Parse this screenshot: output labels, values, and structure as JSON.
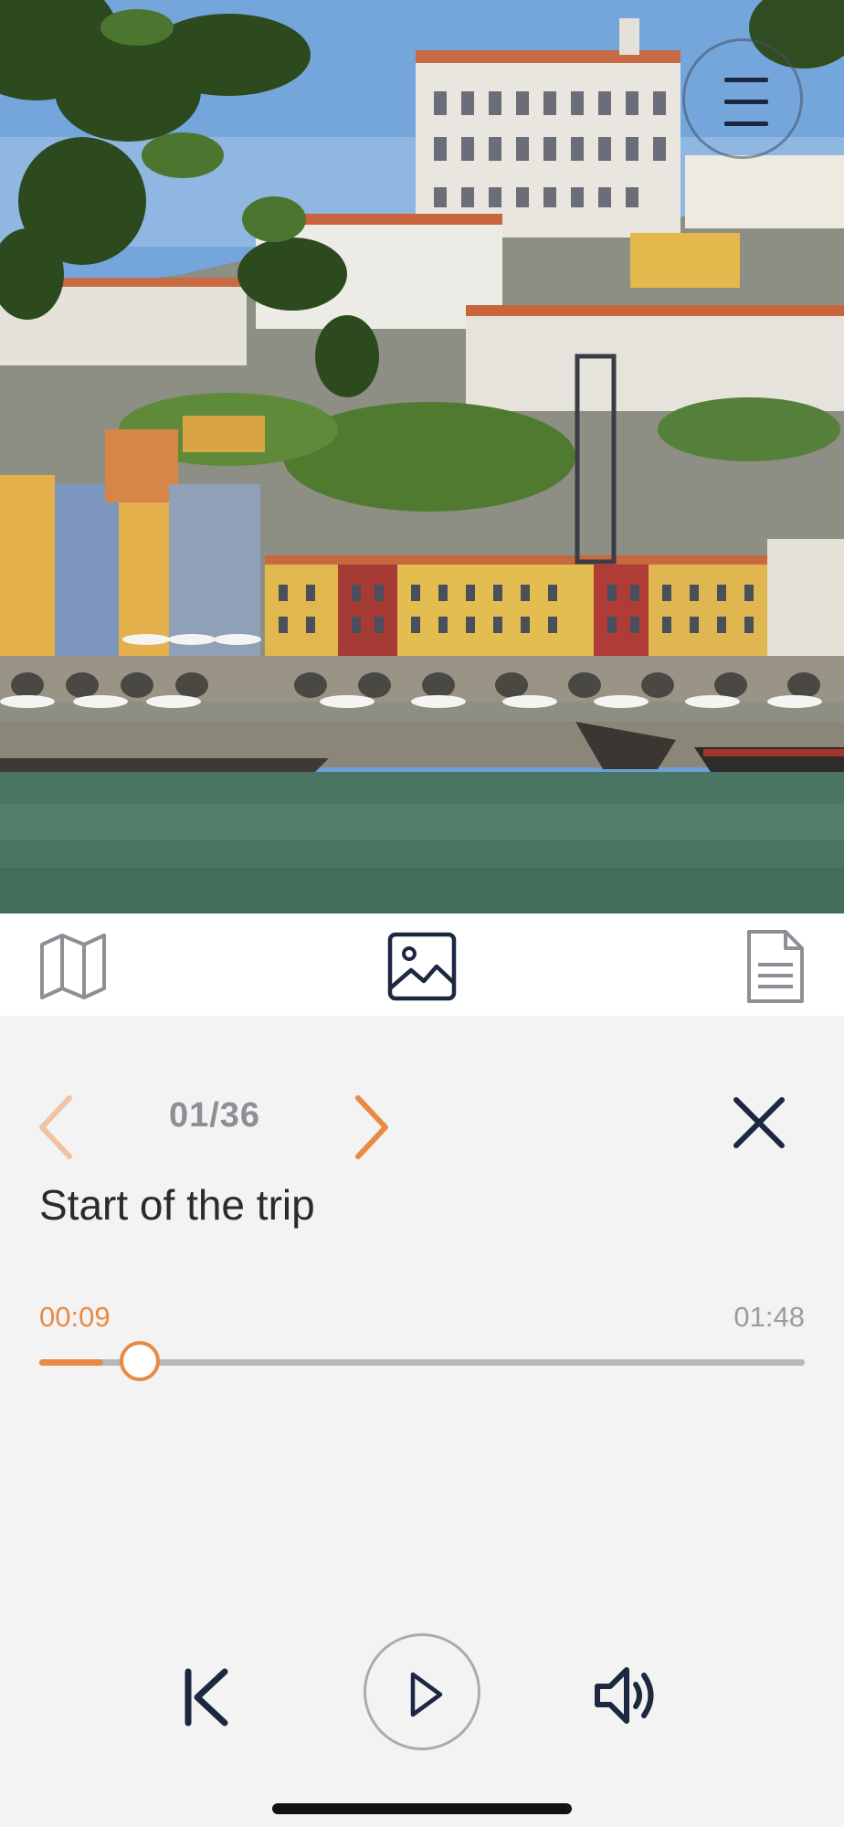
{
  "photo": {
    "description_icon": "landscape-photo"
  },
  "header": {
    "menu_icon": "hamburger-menu-icon"
  },
  "tabs": [
    {
      "icon": "map-icon",
      "active": false
    },
    {
      "icon": "image-icon",
      "active": true
    },
    {
      "icon": "document-icon",
      "active": false
    }
  ],
  "stop": {
    "counter": "01/36",
    "title": "Start of the trip"
  },
  "player": {
    "elapsed": "00:09",
    "total": "01:48",
    "progress": 0.083
  },
  "colors": {
    "accent": "#e88a45",
    "icon_dark": "#1c2740",
    "muted": "#8c8f96"
  }
}
